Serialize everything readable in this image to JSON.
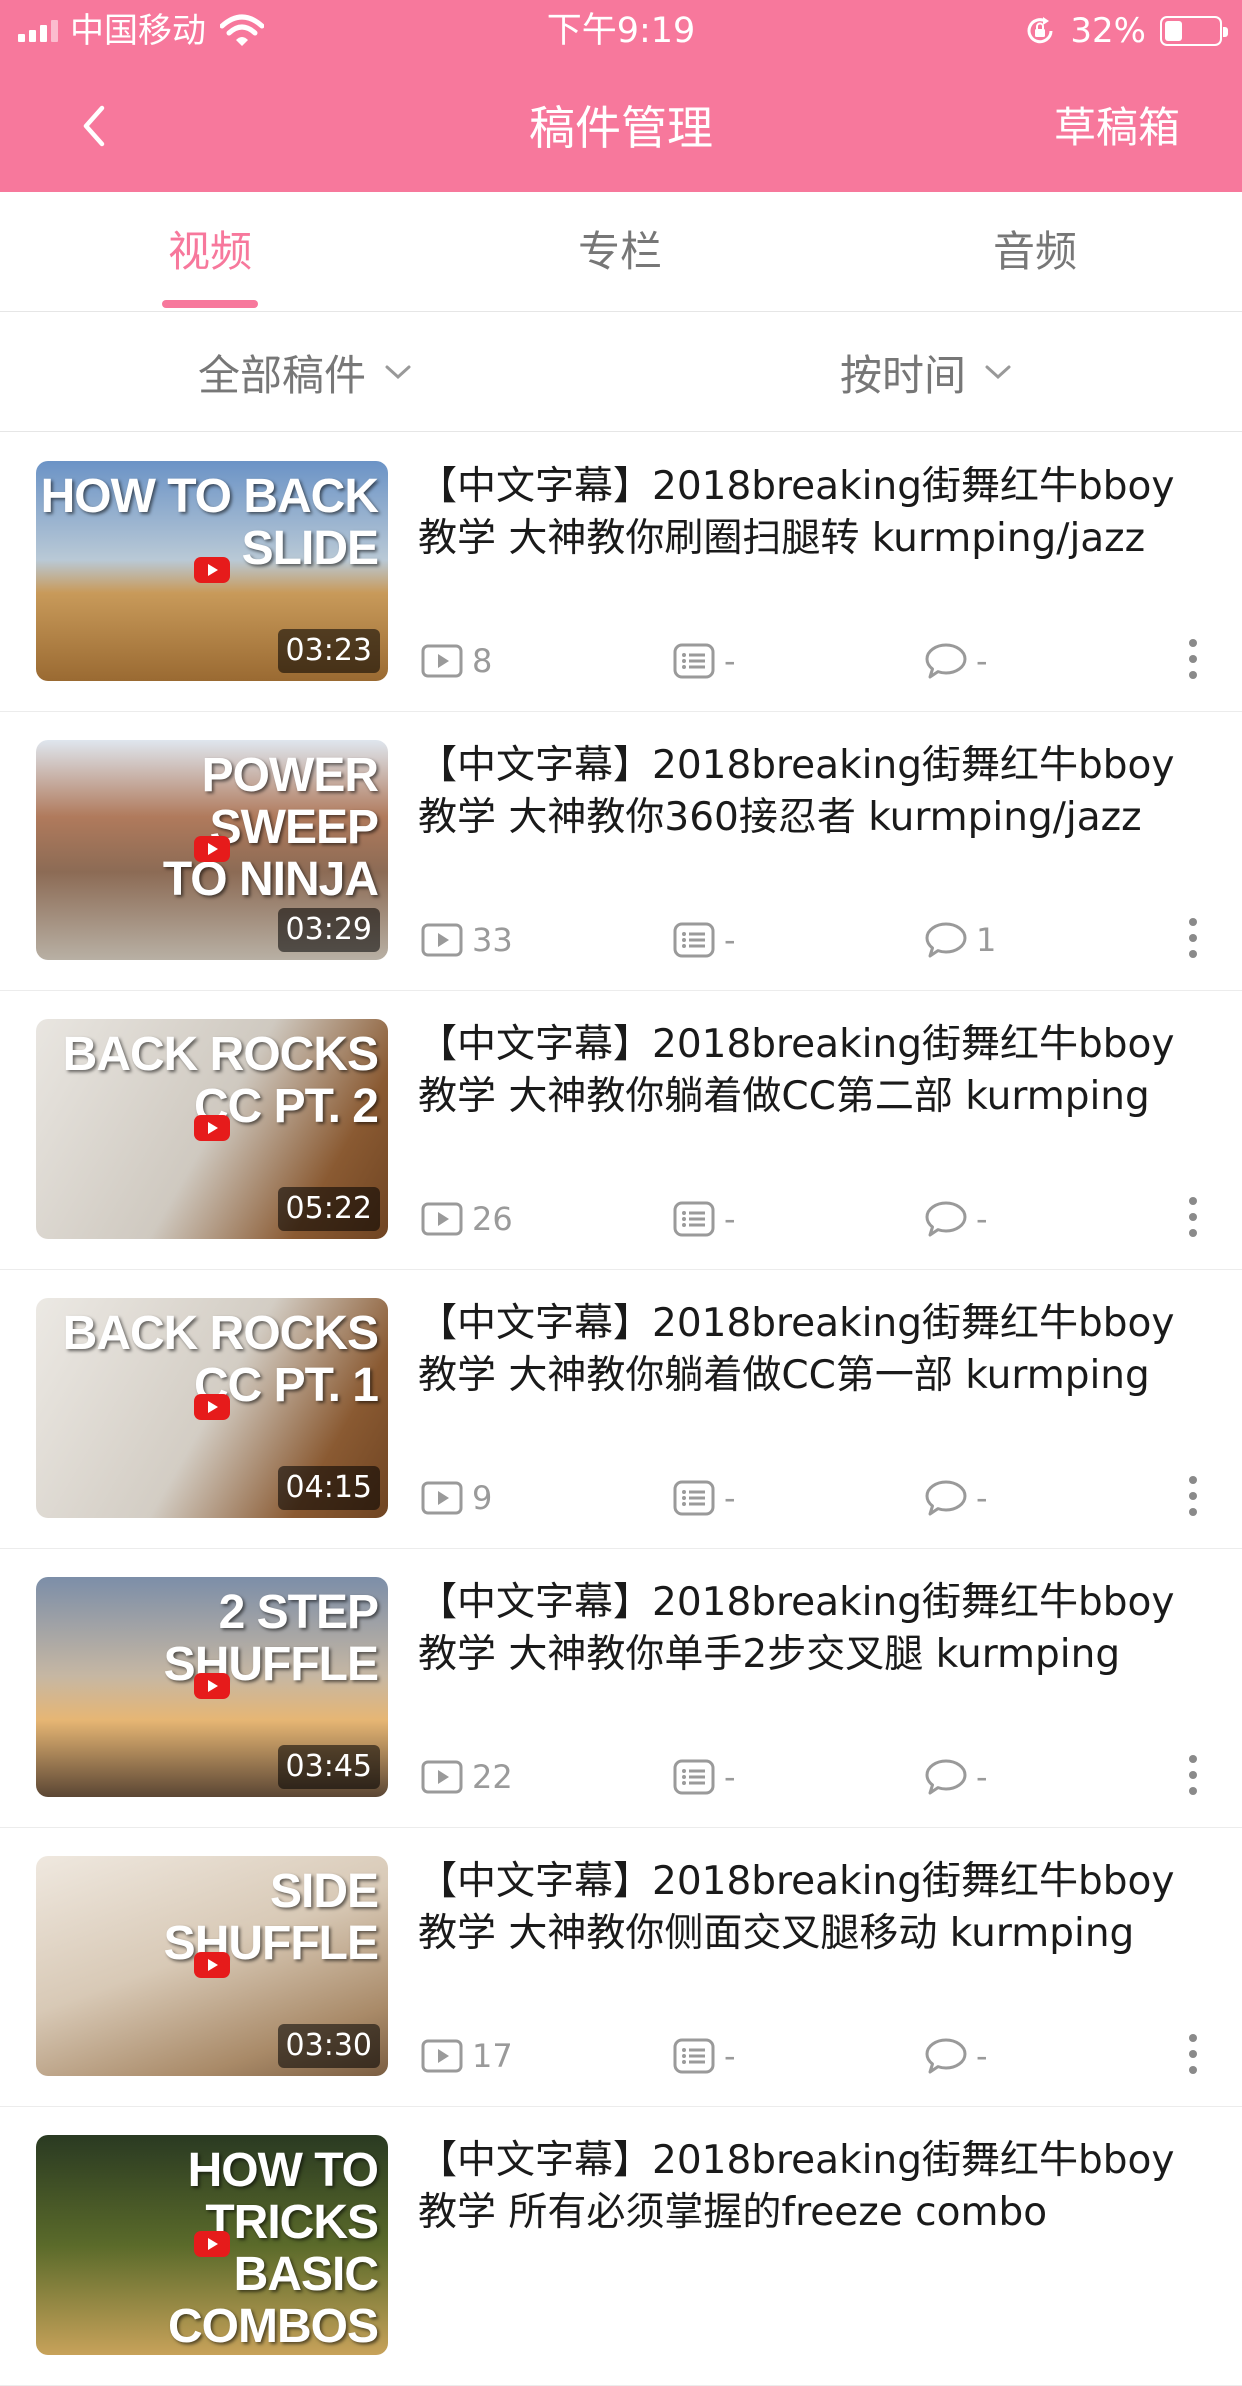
{
  "status_bar": {
    "carrier": "中国移动",
    "time": "下午9:19",
    "battery_pct": "32%",
    "battery_level": 0.32
  },
  "nav": {
    "title": "稿件管理",
    "drafts": "草稿箱"
  },
  "tabs": [
    {
      "label": "视频",
      "active": true
    },
    {
      "label": "专栏",
      "active": false
    },
    {
      "label": "音频",
      "active": false
    }
  ],
  "filters": {
    "all": "全部稿件",
    "sort": "按时间"
  },
  "colors": {
    "accent": "#f7789c"
  },
  "videos": [
    {
      "title": "【中文字幕】2018breaking街舞红牛bboy教学  大神教你刷圈扫腿转    kurmping/jazz",
      "thumb_text": "HOW TO BACK SLIDE",
      "duration": "03:23",
      "plays": "8",
      "danmaku": "-",
      "comments": "-"
    },
    {
      "title": "【中文字幕】2018breaking街舞红牛bboy教学  大神教你360接忍者    kurmping/jazz",
      "thumb_text": "POWER SWEEP\nTO NINJA",
      "duration": "03:29",
      "plays": "33",
      "danmaku": "-",
      "comments": "1"
    },
    {
      "title": "【中文字幕】2018breaking街舞红牛bboy教学  大神教你躺着做CC第二部  kurmping",
      "thumb_text": "BACK ROCKS\nCC PT. 2",
      "duration": "05:22",
      "plays": "26",
      "danmaku": "-",
      "comments": "-"
    },
    {
      "title": "【中文字幕】2018breaking街舞红牛bboy教学  大神教你躺着做CC第一部    kurmping",
      "thumb_text": "BACK ROCKS\nCC PT. 1",
      "duration": "04:15",
      "plays": "9",
      "danmaku": "-",
      "comments": "-"
    },
    {
      "title": "【中文字幕】2018breaking街舞红牛bboy教学  大神教你单手2步交叉腿    kurmping",
      "thumb_text": "2 STEP\nSHUFFLE",
      "duration": "03:45",
      "plays": "22",
      "danmaku": "-",
      "comments": "-"
    },
    {
      "title": "【中文字幕】2018breaking街舞红牛bboy教学  大神教你侧面交叉腿移动    kurmping",
      "thumb_text": "SIDE\nSHUFFLE",
      "duration": "03:30",
      "plays": "17",
      "danmaku": "-",
      "comments": "-"
    },
    {
      "title": "【中文字幕】2018breaking街舞红牛bboy教学  所有必须掌握的freeze combo",
      "thumb_text": "HOW TO TRICKS\nBASIC COMBOS",
      "duration": "",
      "plays": "",
      "danmaku": "",
      "comments": ""
    }
  ]
}
